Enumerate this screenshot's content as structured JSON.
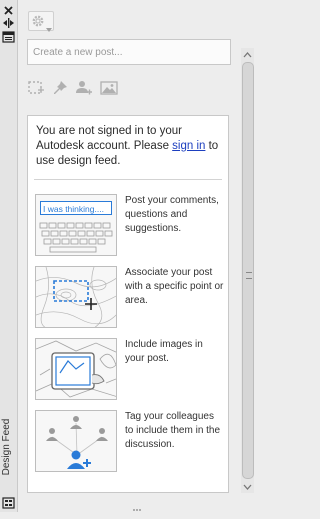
{
  "palette": {
    "title": "Design Feed",
    "close_icon": "close-icon",
    "dock_icon": "dock-arrows-icon",
    "properties_icon": "properties-icon",
    "settings_icon": "settings-icon"
  },
  "toolbar": {
    "gear_icon": "gear-icon",
    "dropdown_icon": "chevron-down-icon"
  },
  "post": {
    "placeholder": "Create a new post..."
  },
  "post_tools": [
    {
      "icon": "select-area-icon"
    },
    {
      "icon": "pin-icon"
    },
    {
      "icon": "add-user-icon"
    },
    {
      "icon": "image-icon"
    }
  ],
  "feed": {
    "signin_before": "You are not signed in to your Autodesk account. Please ",
    "signin_link": "sign in",
    "signin_after": " to use design feed.",
    "cards": [
      {
        "illustration": "keyboard-post-illustration",
        "input_text": "I was thinking....",
        "text": "Post your comments, questions and suggestions."
      },
      {
        "illustration": "map-area-illustration",
        "text": "Associate your post with a specific point or area."
      },
      {
        "illustration": "tablet-image-illustration",
        "text": "Include images in your post."
      },
      {
        "illustration": "tag-users-illustration",
        "text": "Tag your colleagues to include them in the discussion."
      }
    ]
  },
  "colors": {
    "link": "#1d3fbf",
    "accent": "#2a7bd8"
  }
}
